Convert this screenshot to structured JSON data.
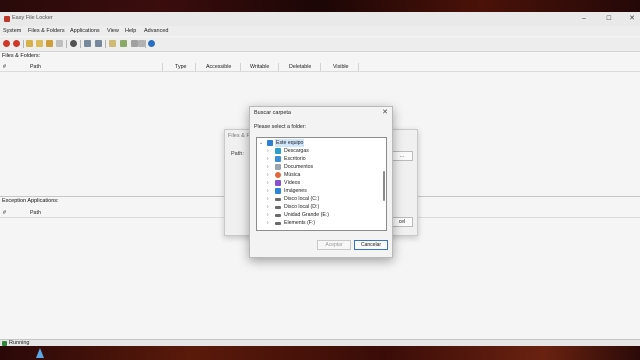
{
  "window": {
    "title": "Easy File Locker"
  },
  "menu": [
    "System",
    "Files & Folders",
    "Applications",
    "View",
    "Help",
    "Advanced"
  ],
  "files_panel": {
    "label": "Files & Folders:",
    "columns": [
      "#",
      "Path",
      "Type",
      "Accessible",
      "Writable",
      "Deletable",
      "Visible"
    ]
  },
  "exceptions_panel": {
    "label": "Exception Applications:",
    "columns": [
      "#",
      "Path"
    ]
  },
  "status": {
    "text": "Running"
  },
  "background_dialog": {
    "title": "Files & F",
    "path_label": "Path:",
    "browse": "...",
    "cancel": "cel"
  },
  "folder_dialog": {
    "title": "Buscar carpeta",
    "prompt": "Please select a folder:",
    "tree": [
      {
        "label": "Este equipo",
        "icon": "computer-icon",
        "selected": true,
        "level": 0,
        "color": "#2d7fd3"
      },
      {
        "label": "Descargas",
        "icon": "downloads-icon",
        "level": 1,
        "color": "#2aa0c9"
      },
      {
        "label": "Escritorio",
        "icon": "desktop-icon",
        "level": 1,
        "color": "#3a8fd8"
      },
      {
        "label": "Documentos",
        "icon": "documents-icon",
        "level": 1,
        "color": "#9aa4ae"
      },
      {
        "label": "Música",
        "icon": "music-icon",
        "level": 1,
        "color": "#e2673a"
      },
      {
        "label": "Vídeos",
        "icon": "videos-icon",
        "level": 1,
        "color": "#8a4fd1"
      },
      {
        "label": "Imágenes",
        "icon": "images-icon",
        "level": 1,
        "color": "#2b84d6"
      },
      {
        "label": "Disco local (C:)",
        "icon": "drive-icon",
        "level": 1,
        "color": "#6a6a6a"
      },
      {
        "label": "Disco local (D:)",
        "icon": "drive-icon",
        "level": 1,
        "color": "#6a6a6a"
      },
      {
        "label": "Unidad Grande (E:)",
        "icon": "drive-icon",
        "level": 1,
        "color": "#6a6a6a"
      },
      {
        "label": "Elements (F:)",
        "icon": "drive-icon",
        "level": 1,
        "color": "#6a6a6a"
      }
    ],
    "accept": "Aceptar",
    "cancel": "Cancelar"
  }
}
